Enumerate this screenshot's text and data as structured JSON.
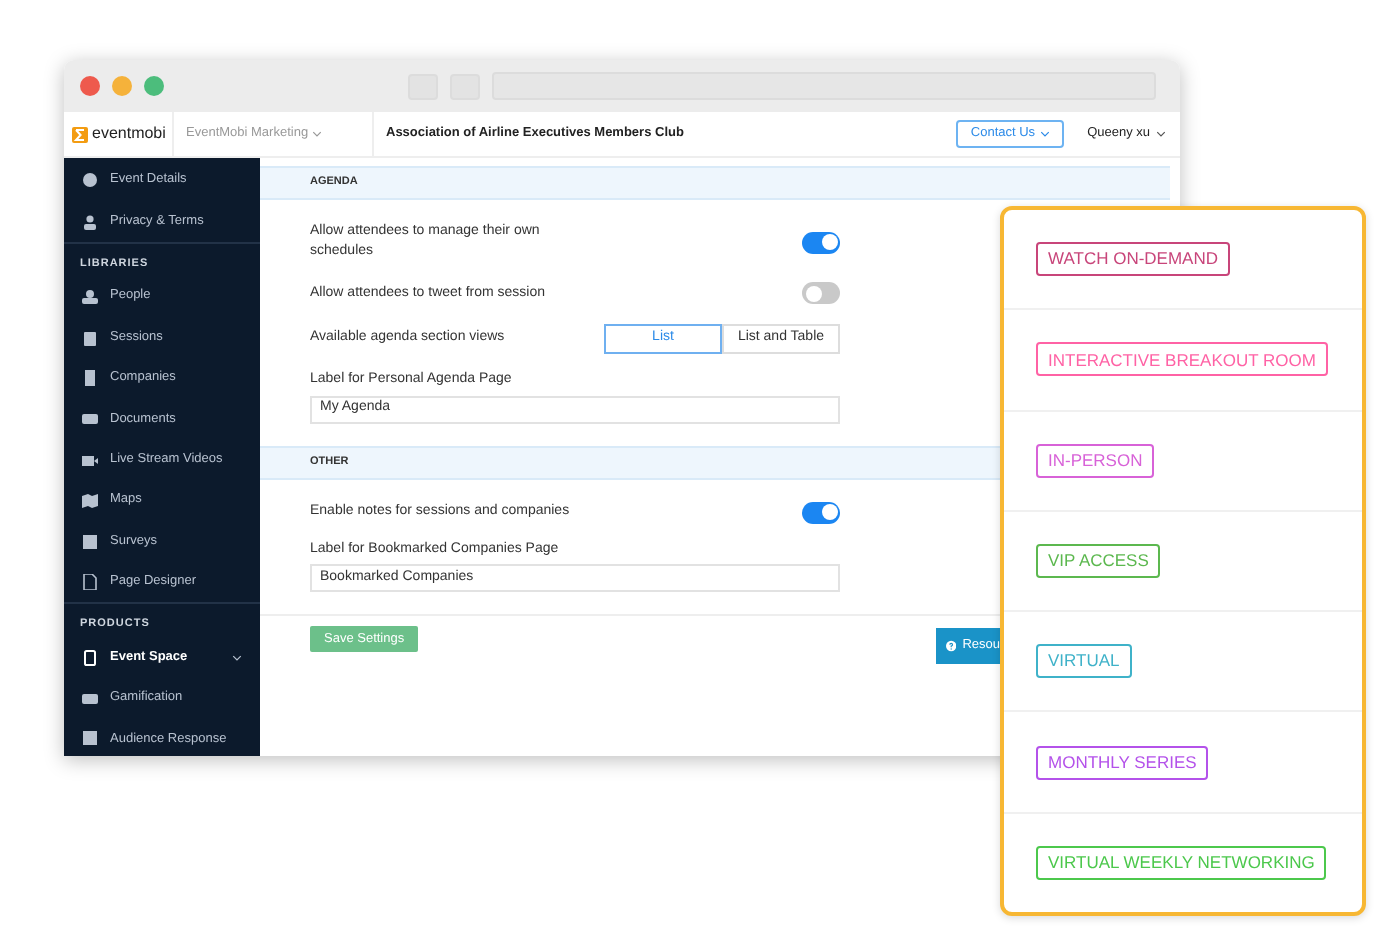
{
  "header": {
    "brand": "eventmobi",
    "org": "EventMobi Marketing",
    "event": "Association of Airline Executives Members Club",
    "contact": "Contact Us",
    "user": "Queeny xu"
  },
  "sidebar": {
    "groups": [
      {
        "items": [
          {
            "label": "Event Details",
            "selected": false,
            "expandable": false
          },
          {
            "label": "Privacy & Terms",
            "selected": false,
            "expandable": false
          }
        ]
      },
      {
        "heading": "LIBRARIES",
        "items": [
          {
            "label": "People",
            "selected": false,
            "expandable": false
          },
          {
            "label": "Sessions",
            "selected": false,
            "expandable": false
          },
          {
            "label": "Companies",
            "selected": false,
            "expandable": false
          },
          {
            "label": "Documents",
            "selected": false,
            "expandable": false
          },
          {
            "label": "Live Stream Videos",
            "selected": false,
            "expandable": false
          },
          {
            "label": "Maps",
            "selected": false,
            "expandable": false
          },
          {
            "label": "Surveys",
            "selected": false,
            "expandable": false
          },
          {
            "label": "Page Designer",
            "selected": false,
            "expandable": false
          }
        ]
      },
      {
        "heading": "PRODUCTS",
        "items": [
          {
            "label": "Event Space",
            "selected": true,
            "expandable": true
          },
          {
            "label": "Gamification",
            "selected": false,
            "expandable": false
          },
          {
            "label": "Audience Response",
            "selected": false,
            "expandable": false
          }
        ]
      }
    ]
  },
  "sections": [
    {
      "title": "AGENDA",
      "settings": [
        {
          "kind": "toggle",
          "label": "Allow attendees to manage their own schedules",
          "on": true
        },
        {
          "kind": "toggle",
          "label": "Allow attendees to tweet from session",
          "on": false
        },
        {
          "kind": "segmented",
          "label": "Available agenda section views",
          "options": [
            {
              "label": "List",
              "selected": true
            },
            {
              "label": "List and Table",
              "selected": false
            }
          ]
        },
        {
          "kind": "text",
          "label": "Label for Personal Agenda Page",
          "value": "My Agenda"
        }
      ]
    },
    {
      "title": "OTHER",
      "settings": [
        {
          "kind": "toggle",
          "label": "Enable notes for sessions and companies",
          "on": true
        },
        {
          "kind": "text",
          "label": "Label for Bookmarked Companies Page",
          "value": "Bookmarked Companies"
        }
      ]
    }
  ],
  "save_button": "Save Settings",
  "resources_button": "Resou",
  "tags": [
    {
      "label": "WATCH ON-DEMAND",
      "color": "#c8457a"
    },
    {
      "label": "INTERACTIVE BREAKOUT ROOM",
      "color": "#ff62a5"
    },
    {
      "label": "IN-PERSON",
      "color": "#d862d8"
    },
    {
      "label": "VIP ACCESS",
      "color": "#5cb84f"
    },
    {
      "label": "VIRTUAL",
      "color": "#3fb2c9"
    },
    {
      "label": "MONTHLY SERIES",
      "color": "#b452ea"
    },
    {
      "label": "VIRTUAL WEEKLY NETWORKING",
      "color": "#4cc84c"
    }
  ]
}
